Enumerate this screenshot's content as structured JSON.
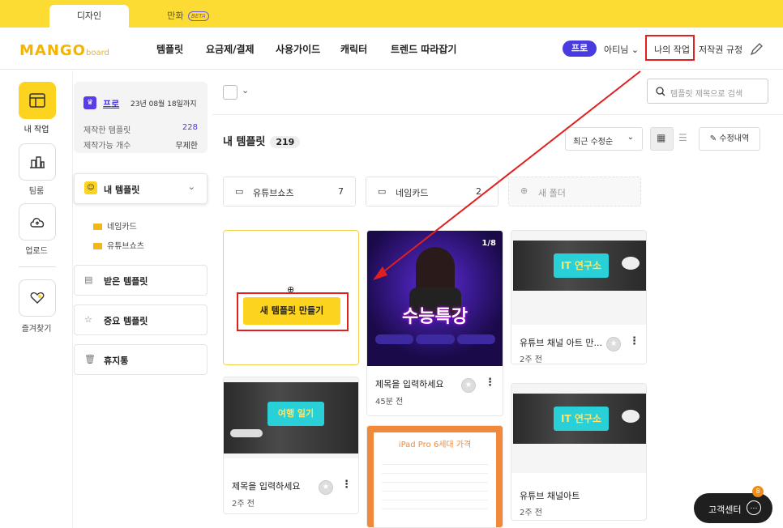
{
  "topbar": {
    "tab_design": "디자인",
    "tab_manhwa": "만화",
    "beta": "BETA"
  },
  "header": {
    "logo_main": "MANGO",
    "logo_sub": "board",
    "nav": [
      "템플릿",
      "요금제/결제",
      "사용가이드",
      "캐릭터",
      "트렌드 따라잡기"
    ],
    "pro_badge": "프로",
    "user": "아티님",
    "my_work": "나의 작업",
    "copyright": "저작권 규정"
  },
  "rail": {
    "my_work": "내 작업",
    "team": "팀룸",
    "upload": "업로드",
    "favorites": "즐겨찾기"
  },
  "sidebar": {
    "plan_label": "프로",
    "plan_expiry": "23년 08월 18일까지",
    "made_label": "제작한 템플릿",
    "made_count": "228",
    "avail_label": "제작가능 개수",
    "avail_value": "무제한",
    "my_templates": "내 템플릿",
    "folders": [
      "네임카드",
      "유튜브쇼츠"
    ],
    "received": "받은 템플릿",
    "important": "중요 템플릿",
    "trash": "휴지통"
  },
  "main": {
    "search_placeholder": "템플릿 제목으로 검색",
    "title": "내 템플릿",
    "count": "219",
    "sort": "최근 수정순",
    "history": "수정내역",
    "folders": [
      {
        "name": "유튜브쇼츠",
        "count": "7"
      },
      {
        "name": "네임카드",
        "count": "2"
      }
    ],
    "new_folder": "새 폴더",
    "new_template": "새 템플릿 만들기",
    "cards": [
      {
        "title": "제목을 입력하세요",
        "time": "45분 전",
        "page": "1/8",
        "thumb_text": "수능특강"
      },
      {
        "title": "유튜브 채널 아트 만...",
        "time": "2주 전",
        "thumb_text": "IT 연구소"
      },
      {
        "title": "제목을 입력하세요",
        "time": "2주 전",
        "thumb_text": "여행 일기"
      },
      {
        "title": "유튜브 채널아트",
        "time": "2주 전",
        "thumb_text": "IT 연구소"
      },
      {
        "thumb_text": "iPad Pro 6세대 가격"
      }
    ]
  },
  "help": {
    "label": "고객센터",
    "badge": "8"
  },
  "colors": {
    "accent": "#fcd31e",
    "brand": "#4a3be0",
    "annotation": "#e02020"
  }
}
